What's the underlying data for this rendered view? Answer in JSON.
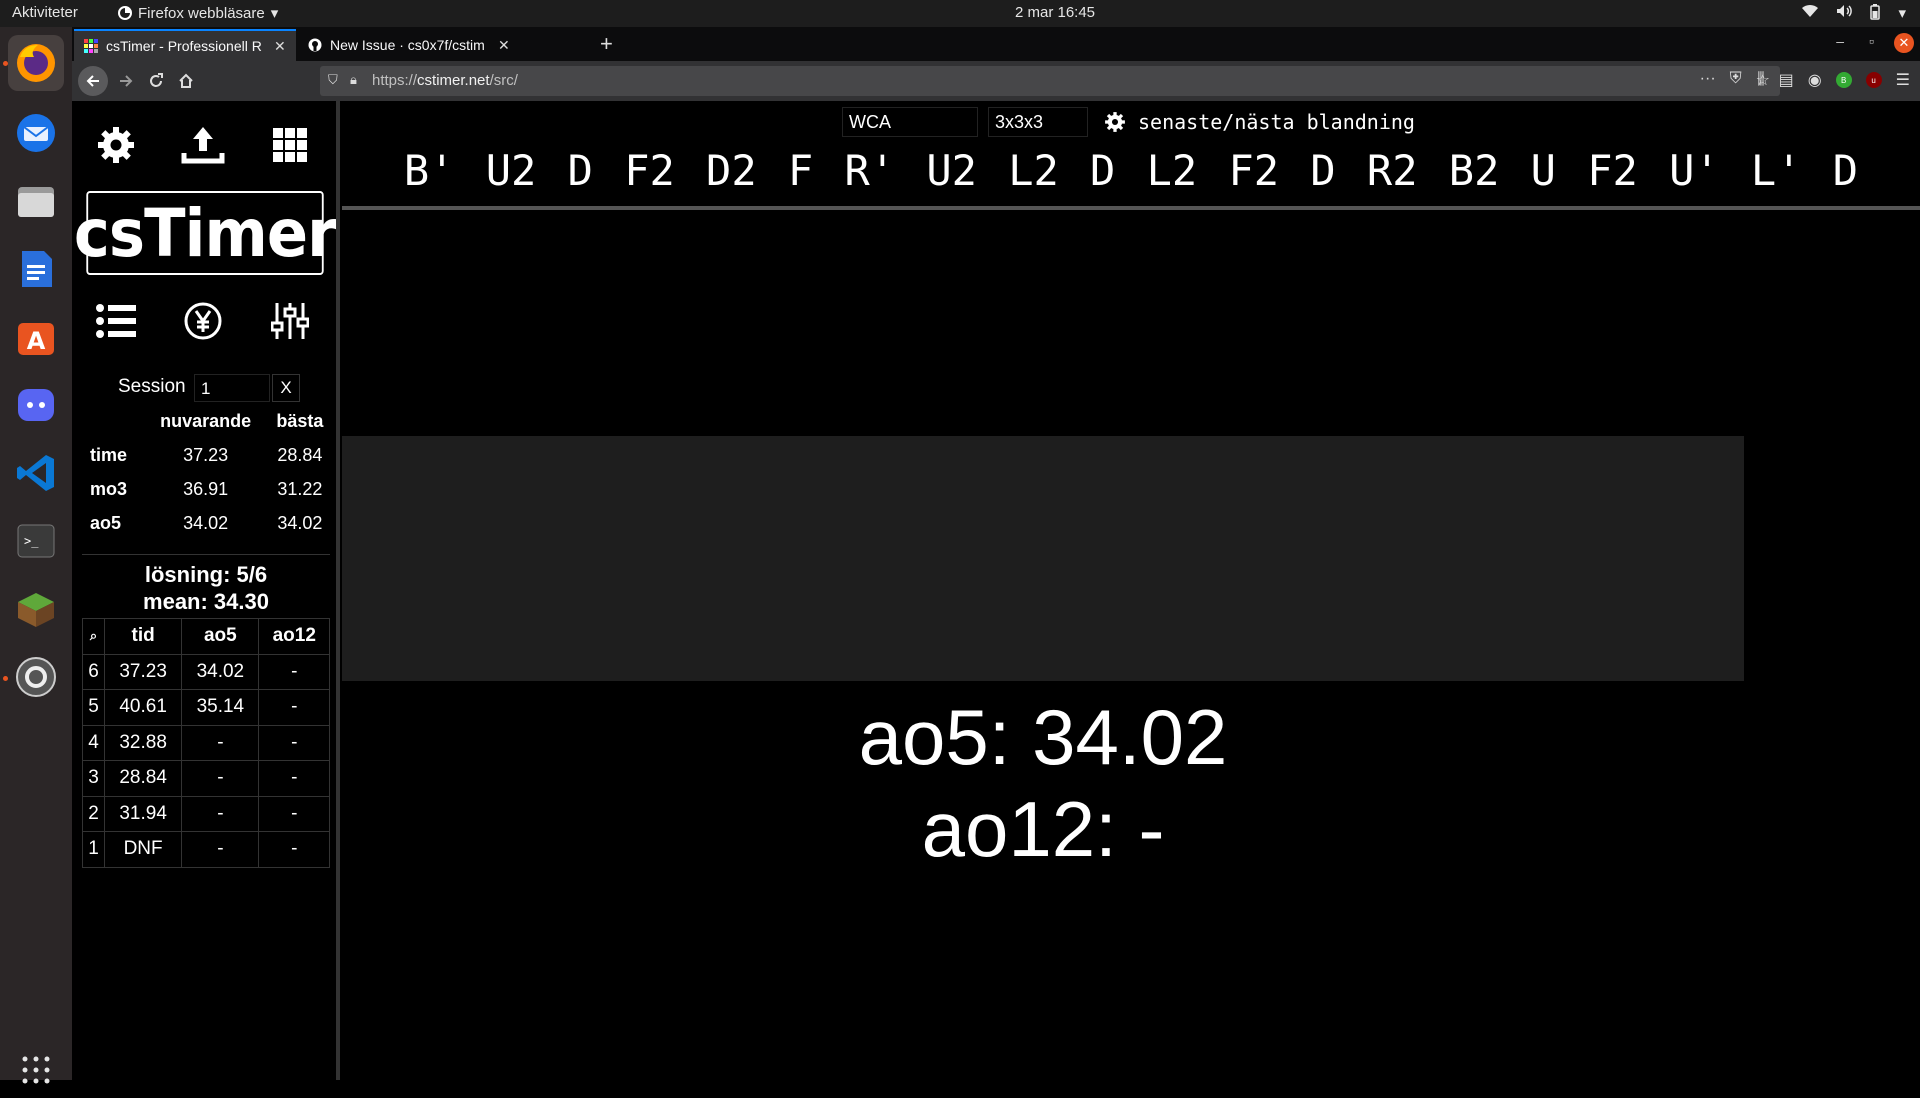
{
  "system": {
    "activities": "Aktiviteter",
    "app_name": "Firefox webbläsare",
    "clock": "2 mar  16:45"
  },
  "browser": {
    "tabs": [
      {
        "title": "csTimer - Professionell R"
      },
      {
        "title": "New Issue · cs0x7f/cstim"
      }
    ],
    "url_prefix": "https://",
    "url_domain": "cstimer.net",
    "url_path": "/src/"
  },
  "cstimer": {
    "logo": "csTimer",
    "session": {
      "label": "Session",
      "value": "1",
      "delete_label": "X"
    },
    "stats": {
      "headers": [
        "",
        "nuvarande",
        "bästa"
      ],
      "rows": [
        {
          "label": "time",
          "current": "37.23",
          "best": "28.84"
        },
        {
          "label": "mo3",
          "current": "36.91",
          "best": "31.22"
        },
        {
          "label": "ao5",
          "current": "34.02",
          "best": "34.02"
        }
      ]
    },
    "summary": {
      "solves": "lösning: 5/6",
      "mean": "mean: 34.30"
    },
    "times": {
      "headers": [
        "⌕",
        "tid",
        "ao5",
        "ao12"
      ],
      "rows": [
        {
          "n": "6",
          "time": "37.23",
          "ao5": "34.02",
          "ao12": "-"
        },
        {
          "n": "5",
          "time": "40.61",
          "ao5": "35.14",
          "ao12": "-"
        },
        {
          "n": "4",
          "time": "32.88",
          "ao5": "-",
          "ao12": "-"
        },
        {
          "n": "3",
          "time": "28.84",
          "ao5": "-",
          "ao12": "-"
        },
        {
          "n": "2",
          "time": "31.94",
          "ao5": "-",
          "ao12": "-"
        },
        {
          "n": "1",
          "time": "DNF",
          "ao5": "-",
          "ao12": "-"
        }
      ]
    },
    "scramble": {
      "type": "WCA",
      "puzzle": "3x3x3",
      "nav_label": "senaste/nästa blandning",
      "moves": "B' U2 D F2 D2 F R' U2 L2 D L2 F2 D R2 B2 U F2 U' L' D"
    },
    "averages": {
      "ao5": "ao5: 34.02",
      "ao12": "ao12: -"
    }
  }
}
